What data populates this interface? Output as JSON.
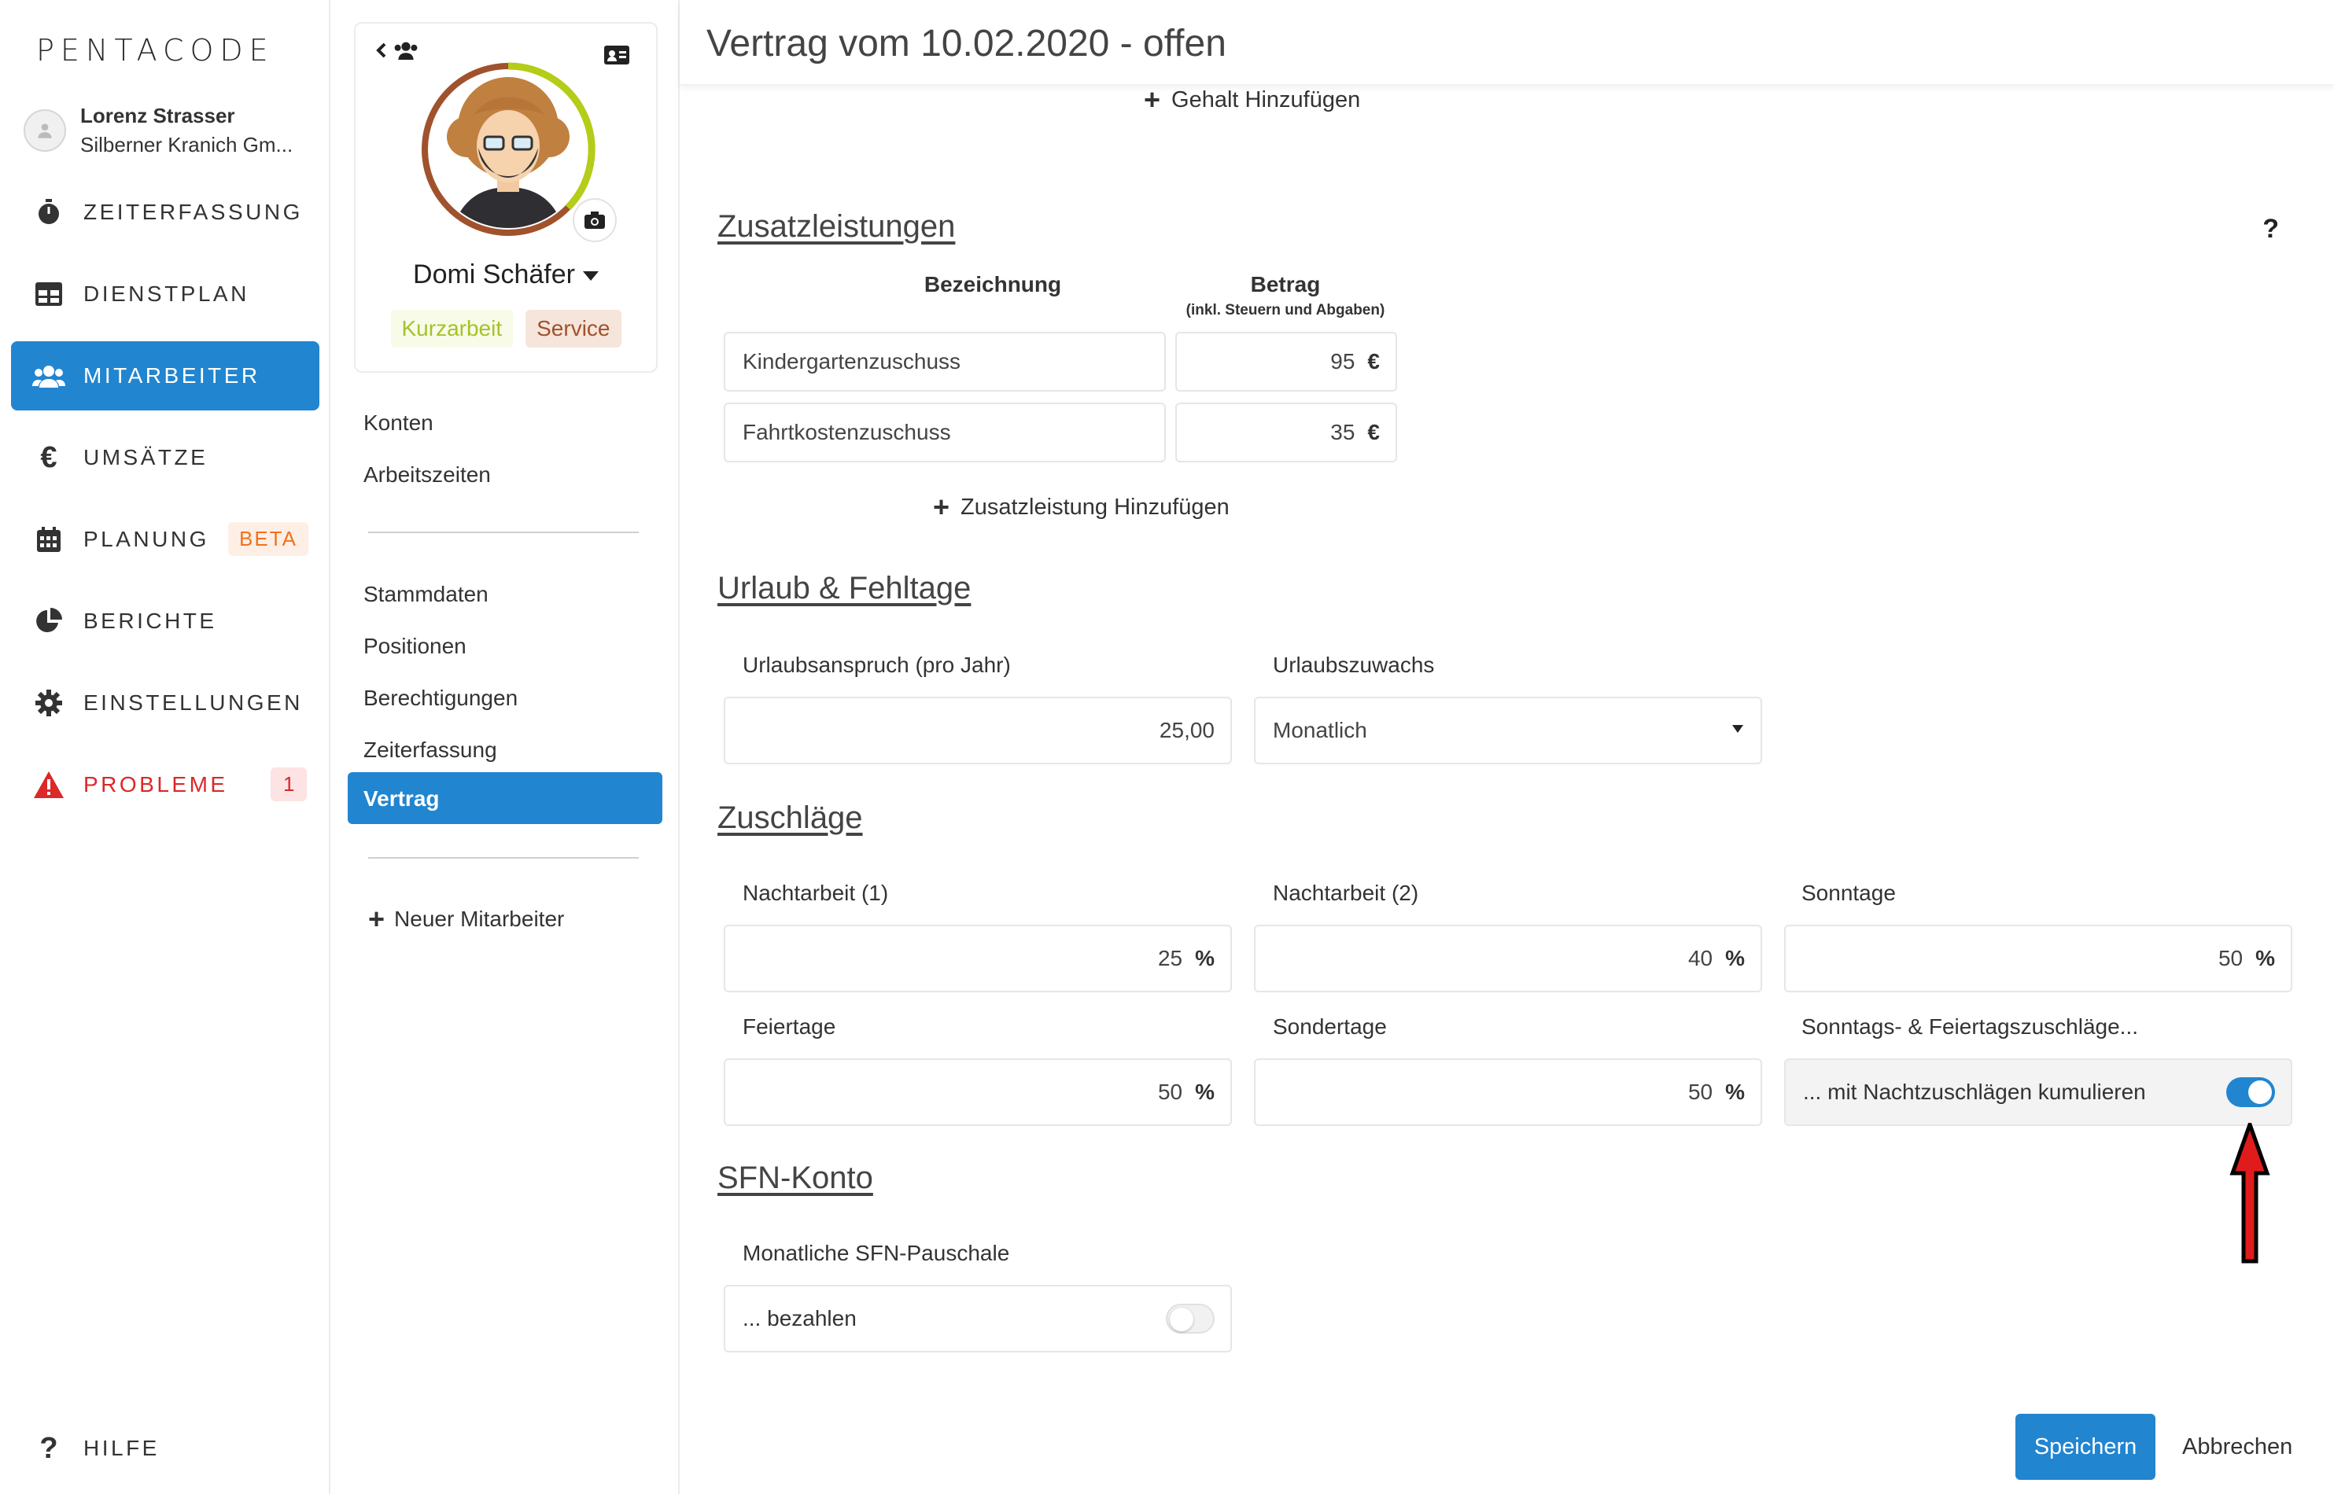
{
  "app": {
    "logo": "PENTACODE",
    "user": {
      "name": "Lorenz Strasser",
      "company": "Silberner Kranich Gm..."
    }
  },
  "nav": {
    "items": [
      {
        "label": "ZEITERFASSUNG",
        "icon": "stopwatch-icon"
      },
      {
        "label": "DIENSTPLAN",
        "icon": "table-icon"
      },
      {
        "label": "MITARBEITER",
        "icon": "users-icon",
        "active": true
      },
      {
        "label": "UMSÄTZE",
        "icon": "euro-icon"
      },
      {
        "label": "PLANUNG",
        "icon": "calendar-icon",
        "badge": "BETA"
      },
      {
        "label": "BERICHTE",
        "icon": "pie-chart-icon"
      },
      {
        "label": "EINSTELLUNGEN",
        "icon": "gear-icon"
      },
      {
        "label": "PROBLEME",
        "icon": "warning-icon",
        "badge": "1"
      }
    ],
    "help": "HILFE"
  },
  "employee": {
    "name": "Domi Schäfer",
    "tags": [
      "Kurzarbeit",
      "Service"
    ],
    "menu_top": [
      "Konten",
      "Arbeitszeiten"
    ],
    "menu_main": [
      "Stammdaten",
      "Positionen",
      "Berechtigungen",
      "Zeiterfassung",
      "Vertrag"
    ],
    "new_employee": "Neuer Mitarbeiter"
  },
  "contract": {
    "title": "Vertrag vom 10.02.2020 - offen",
    "add_salary": "Gehalt Hinzufügen",
    "help": "?",
    "zusatz": {
      "heading": "Zusatzleistungen",
      "col_name": "Bezeichnung",
      "col_amount": "Betrag",
      "col_amount_note": "(inkl. Steuern und Abgaben)",
      "rows": [
        {
          "name": "Kindergartenzuschuss",
          "amount": "95",
          "unit": "€"
        },
        {
          "name": "Fahrtkostenzuschuss",
          "amount": "35",
          "unit": "€"
        }
      ],
      "add": "Zusatzleistung Hinzufügen"
    },
    "urlaub": {
      "heading": "Urlaub & Fehltage",
      "anspruch_label": "Urlaubsanspruch (pro Jahr)",
      "anspruch_value": "25,00",
      "zuwachs_label": "Urlaubszuwachs",
      "zuwachs_value": "Monatlich"
    },
    "zuschlaege": {
      "heading": "Zuschläge",
      "nacht1_label": "Nachtarbeit (1)",
      "nacht1_value": "25",
      "nacht2_label": "Nachtarbeit (2)",
      "nacht2_value": "40",
      "sonntage_label": "Sonntage",
      "sonntage_value": "50",
      "feiertage_label": "Feiertage",
      "feiertage_value": "50",
      "sondertage_label": "Sondertage",
      "sondertage_value": "50",
      "kumul_label": "Sonntags- & Feiertagszuschläge...",
      "kumul_text": "... mit Nachtzuschlägen kumulieren",
      "kumul_on": true,
      "unit": "%"
    },
    "sfn": {
      "heading": "SFN-Konto",
      "pauschale_label": "Monatliche SFN-Pauschale",
      "pauschale_text": "... bezahlen",
      "pauschale_on": false
    },
    "save": "Speichern",
    "cancel": "Abbrechen"
  },
  "colors": {
    "accent": "#2185d0",
    "problem": "#db2828",
    "beta": "#f2711c"
  }
}
